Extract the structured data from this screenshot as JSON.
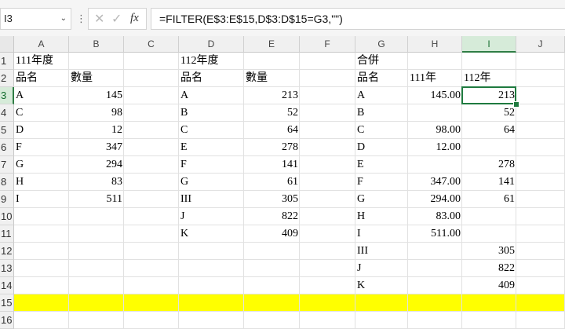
{
  "formula_bar": {
    "name_box": "I3",
    "cancel_icon": "cancel-x-icon",
    "enter_icon": "checkmark-icon",
    "fx_label": "fx",
    "formula": "=FILTER(E$3:E$15,D$3:D$15=G3,\"\")"
  },
  "columns": [
    "A",
    "B",
    "C",
    "D",
    "E",
    "F",
    "G",
    "H",
    "I",
    "J"
  ],
  "rows": [
    "1",
    "2",
    "3",
    "4",
    "5",
    "6",
    "7",
    "8",
    "9",
    "10",
    "11",
    "12",
    "13",
    "14",
    "15",
    "16"
  ],
  "active_cell": "I3",
  "highlight_row": "15",
  "highlight_color": "#ffff00",
  "selection_color": "#1f7a3f",
  "cells": {
    "A1": "111年度",
    "A2": "品名",
    "B2": "數量",
    "A3": "A",
    "B3": "145",
    "A4": "C",
    "B4": "98",
    "A5": "D",
    "B5": "12",
    "A6": "F",
    "B6": "347",
    "A7": "G",
    "B7": "294",
    "A8": "H",
    "B8": "83",
    "A9": "I",
    "B9": "511",
    "D1": "112年度",
    "D2": "品名",
    "E2": "數量",
    "D3": "A",
    "E3": "213",
    "D4": "B",
    "E4": "52",
    "D5": "C",
    "E5": "64",
    "D6": "E",
    "E6": "278",
    "D7": "F",
    "E7": "141",
    "D8": "G",
    "E8": "61",
    "D9": "III",
    "E9": "305",
    "D10": "J",
    "E10": "822",
    "D11": "K",
    "E11": "409",
    "G1": "合併",
    "G2": "品名",
    "H2": "111年",
    "I2": "112年",
    "G3": "A",
    "H3": "145.00",
    "I3": "213",
    "G4": "B",
    "I4": "52",
    "G5": "C",
    "H5": "98.00",
    "I5": "64",
    "G6": "D",
    "H6": "12.00",
    "G7": "E",
    "I7": "278",
    "G8": "F",
    "H8": "347.00",
    "I8": "141",
    "G9": "G",
    "H9": "294.00",
    "I9": "61",
    "G10": "H",
    "H10": "83.00",
    "G11": "I",
    "H11": "511.00",
    "G12": "III",
    "I12": "305",
    "G13": "J",
    "I13": "822",
    "G14": "K",
    "I14": "409"
  }
}
